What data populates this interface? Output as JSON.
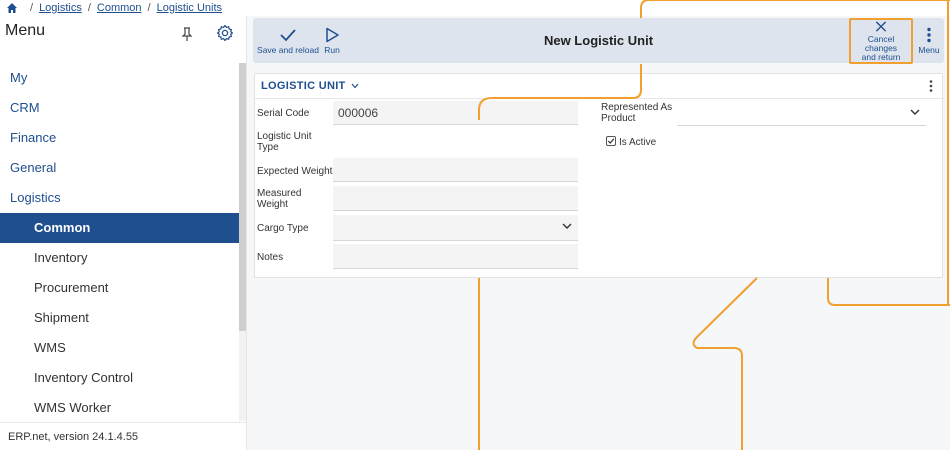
{
  "breadcrumb": {
    "items": [
      "Logistics",
      "Common",
      "Logistic Units"
    ]
  },
  "sidebar": {
    "title": "Menu",
    "items": [
      {
        "label": "My",
        "level": "top"
      },
      {
        "label": "CRM",
        "level": "top"
      },
      {
        "label": "Finance",
        "level": "top"
      },
      {
        "label": "General",
        "level": "top"
      },
      {
        "label": "Logistics",
        "level": "top"
      },
      {
        "label": "Common",
        "level": "sub",
        "active": true
      },
      {
        "label": "Inventory",
        "level": "sub"
      },
      {
        "label": "Procurement",
        "level": "sub"
      },
      {
        "label": "Shipment",
        "level": "sub"
      },
      {
        "label": "WMS",
        "level": "sub"
      },
      {
        "label": "Inventory Control",
        "level": "sub"
      },
      {
        "label": "WMS Worker",
        "level": "sub"
      }
    ],
    "version": "ERP.net, version 24.1.4.55"
  },
  "toolbar": {
    "save_label": "Save and reload",
    "run_label": "Run",
    "title": "New Logistic Unit",
    "cancel_line1": "Cancel changes",
    "cancel_line2": "and return",
    "menu_label": "Menu"
  },
  "form": {
    "section_title": "LOGISTIC UNIT",
    "serial_code_label": "Serial Code",
    "serial_code_value": "000006",
    "unit_type_label1": "Logistic Unit",
    "unit_type_label2": "Type",
    "expected_weight_label": "Expected Weight",
    "measured_weight_label1": "Measured",
    "measured_weight_label2": "Weight",
    "cargo_type_label": "Cargo Type",
    "notes_label": "Notes",
    "represented_label1": "Represented As",
    "represented_label2": "Product",
    "is_active_label": "Is Active",
    "is_active_checked": true
  },
  "colors": {
    "accent": "#1f4f8f",
    "highlight": "#f0a030",
    "toolbar_bg": "#dde4ee"
  }
}
